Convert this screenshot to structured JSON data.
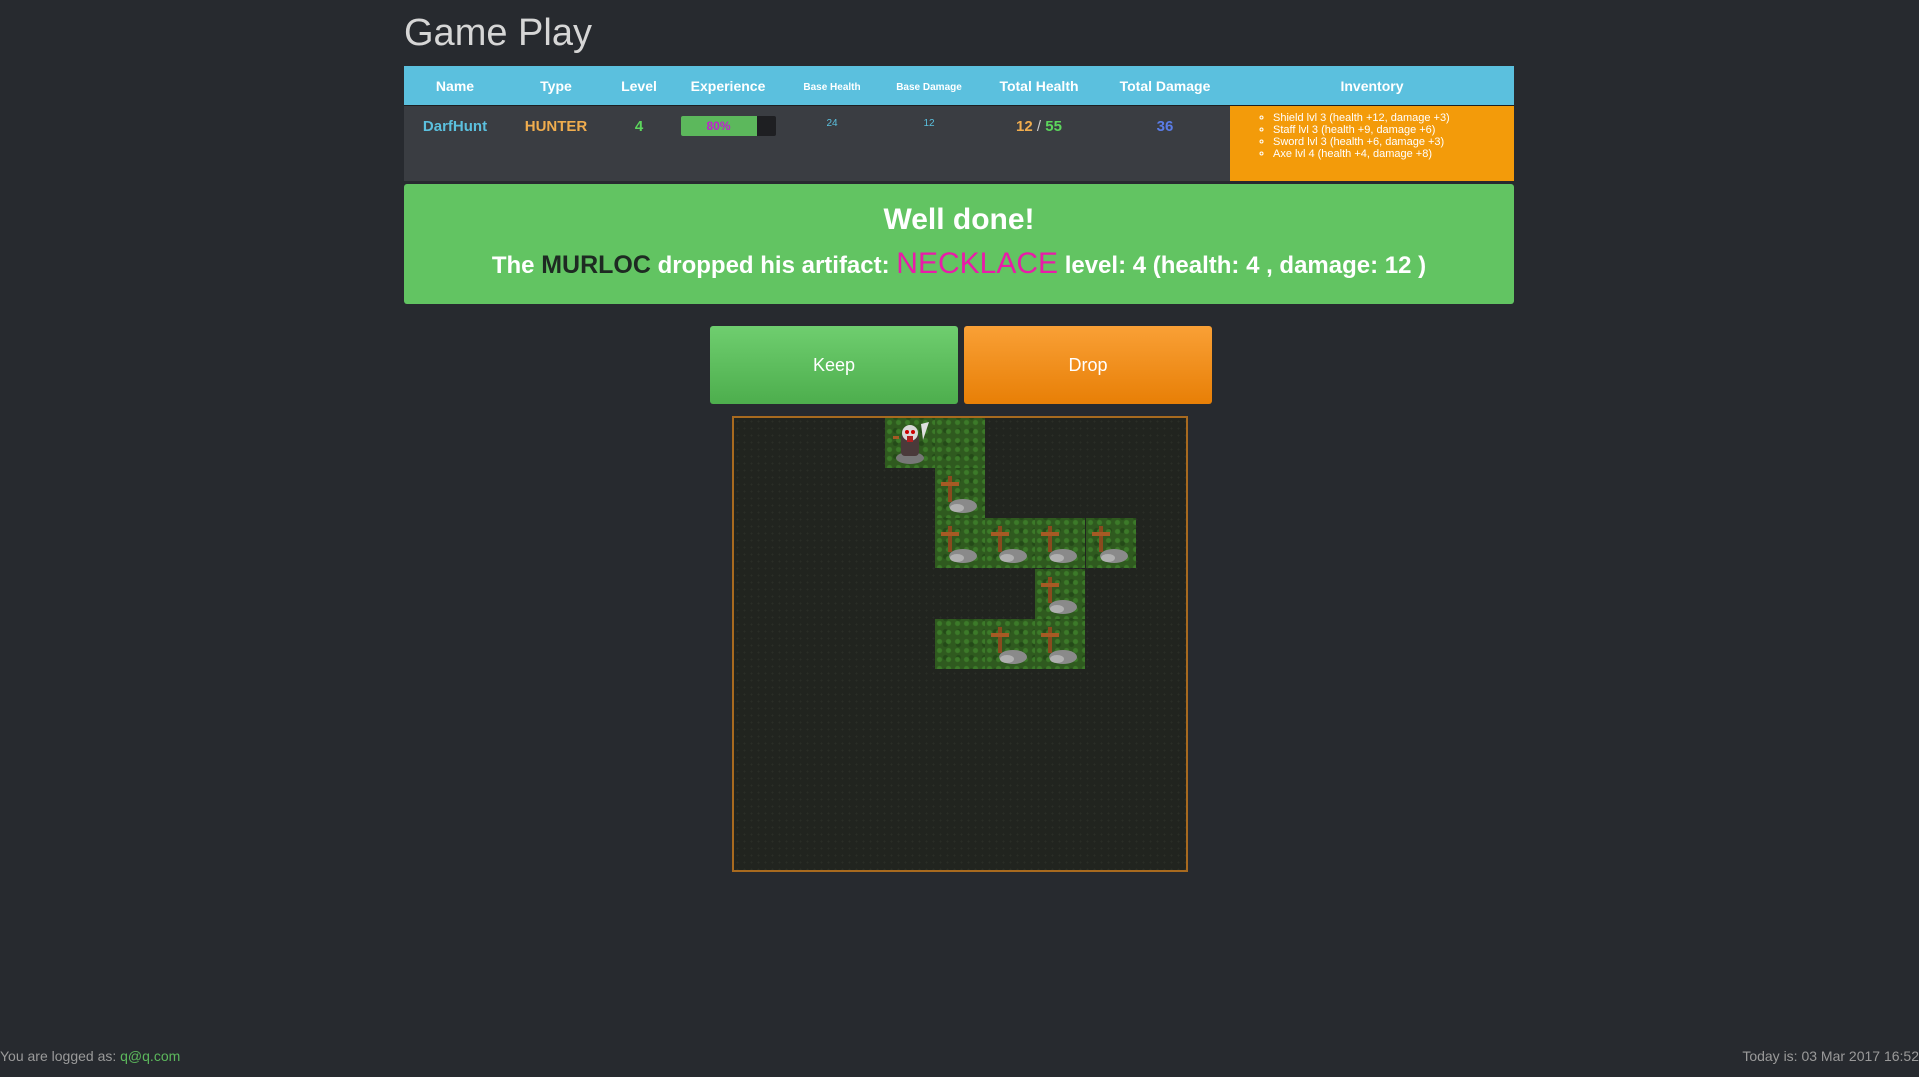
{
  "page": {
    "title": "Game Play"
  },
  "stats": {
    "headers": {
      "name": "Name",
      "type": "Type",
      "level": "Level",
      "experience": "Experience",
      "base_health": "Base Health",
      "base_damage": "Base Damage",
      "total_health": "Total Health",
      "total_damage": "Total Damage",
      "inventory": "Inventory"
    },
    "player": {
      "name": "DarfHunt",
      "type": "HUNTER",
      "level": "4",
      "experience_label": "80%",
      "experience_fraction": 0.8,
      "base_health": "24",
      "base_damage": "12",
      "health_current": "12",
      "health_sep": "/",
      "health_max": "55",
      "total_damage": "36"
    },
    "inventory": [
      "Shield lvl 3 (health +12, damage +3)",
      "Staff lvl 3 (health +9, damage +6)",
      "Sword lvl 3 (health +6, damage +3)",
      "Axe lvl 4 (health +4, damage +8)"
    ]
  },
  "alert": {
    "heading": "Well done!",
    "prefix": "The",
    "monster": "MURLOC",
    "middle": "dropped his artifact:",
    "artifact": "NECKLACE",
    "suffix": "level: 4 (health: 4 , damage: 12 )"
  },
  "actions": {
    "keep_label": "Keep",
    "drop_label": "Drop"
  },
  "board": {
    "grid_size": 9,
    "player_cell": {
      "col": 3,
      "row": 0
    },
    "tiles": [
      {
        "col": 3,
        "row": 0,
        "content": "player"
      },
      {
        "col": 4,
        "row": 0,
        "content": "empty"
      },
      {
        "col": 4,
        "row": 1,
        "content": "grave"
      },
      {
        "col": 4,
        "row": 2,
        "content": "grave"
      },
      {
        "col": 5,
        "row": 2,
        "content": "grave"
      },
      {
        "col": 6,
        "row": 2,
        "content": "grave"
      },
      {
        "col": 7,
        "row": 2,
        "content": "grave"
      },
      {
        "col": 6,
        "row": 3,
        "content": "grave"
      },
      {
        "col": 4,
        "row": 4,
        "content": "empty"
      },
      {
        "col": 5,
        "row": 4,
        "content": "grave"
      },
      {
        "col": 6,
        "row": 4,
        "content": "grave"
      }
    ]
  },
  "footer": {
    "logged_prefix": "You are logged as:",
    "user": "q@q.com",
    "date": "Today is: 03 Mar 2017 16:52"
  },
  "colors": {
    "header_blue": "#5bc0de",
    "name_blue": "#5bc0de",
    "type_orange": "#f0ad4e",
    "level_green": "#5cd65c",
    "inventory_orange": "#f39b0a",
    "alert_green": "#62c462",
    "artifact_pink": "#e91ba9",
    "damage_blue": "#5a7ce6"
  }
}
